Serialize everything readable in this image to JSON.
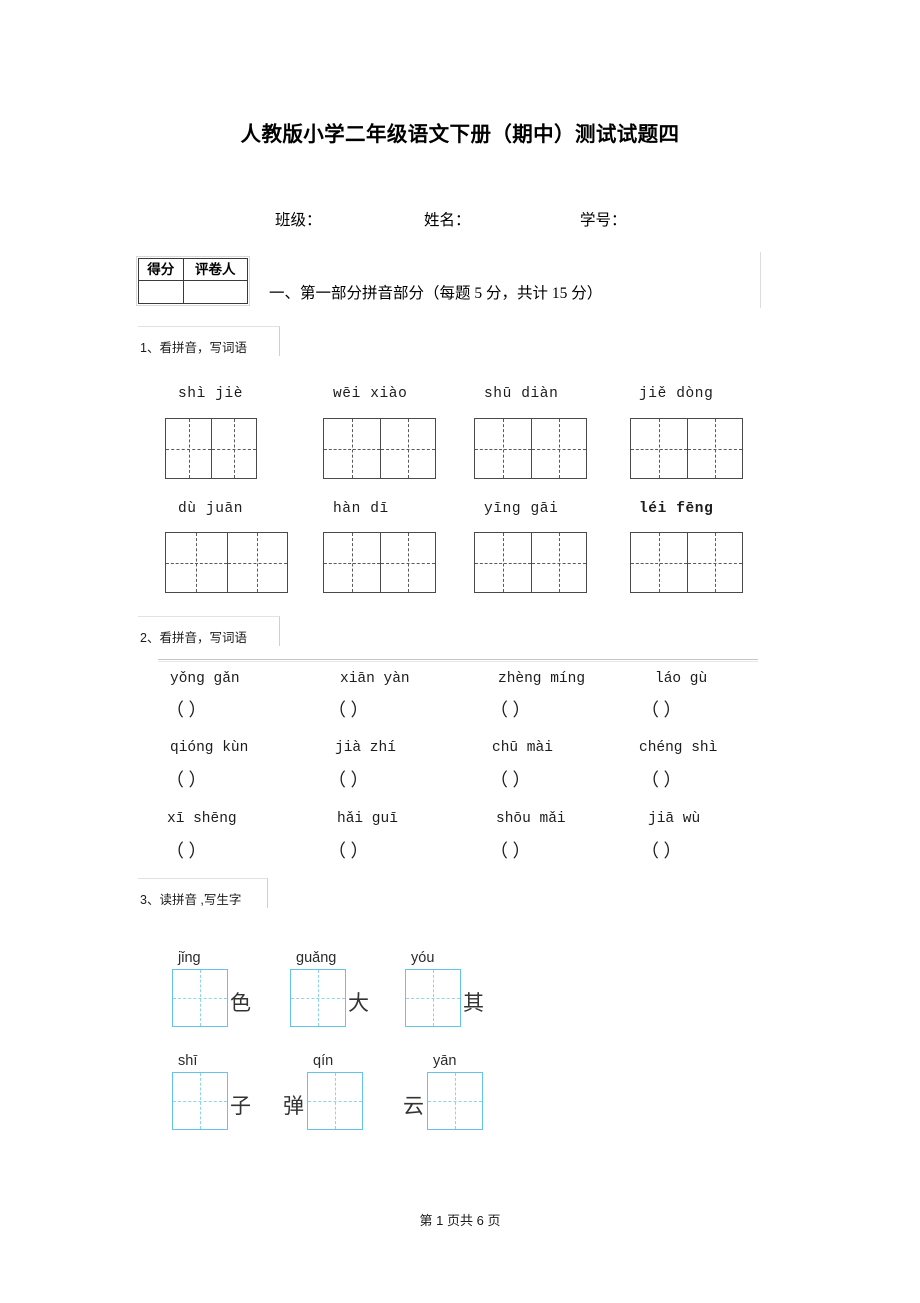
{
  "document": {
    "title": "人教版小学二年级语文下册（期中）测试试题四",
    "footer": "第    1 页共 6 页"
  },
  "student_info": {
    "fields": [
      {
        "label": "班级："
      },
      {
        "label": "姓名："
      },
      {
        "label": "学号："
      }
    ]
  },
  "score_table": {
    "headers": [
      "得分",
      "评卷人"
    ],
    "values": [
      "",
      ""
    ]
  },
  "section": {
    "heading": "一、第一部分拼音部分（每题  5 分，共计 15 分）"
  },
  "questions": [
    {
      "label": "1、看拼音，写词语",
      "rows": [
        [
          {
            "pinyin": "shì  jiè"
          },
          {
            "pinyin": "wēi  xiào"
          },
          {
            "pinyin": "shū  diàn"
          },
          {
            "pinyin": "jiě  dòng"
          }
        ],
        [
          {
            "pinyin": "dù   juān"
          },
          {
            "pinyin": "hàn   dī"
          },
          {
            "pinyin": "yīng  gāi"
          },
          {
            "pinyin": "léi fēng"
          }
        ]
      ]
    },
    {
      "label": "2、看拼音，写词语",
      "rows": [
        [
          {
            "pinyin": "yǒng  gǎn",
            "answer": "（                ）"
          },
          {
            "pinyin": "xiān yàn",
            "answer": "（                ）"
          },
          {
            "pinyin": "zhèng míng",
            "answer": "（                ）"
          },
          {
            "pinyin": "láo  gù",
            "answer": "（                ）"
          }
        ],
        [
          {
            "pinyin": "qióng kùn",
            "answer": "（                ）"
          },
          {
            "pinyin": "jià   zhí",
            "answer": "（                ）"
          },
          {
            "pinyin": "chū   mài",
            "answer": "（                ）"
          },
          {
            "pinyin": "chéng shì",
            "answer": "（                ）"
          }
        ],
        [
          {
            "pinyin": "xī shēng",
            "answer": "（                ）"
          },
          {
            "pinyin": "hǎi  guī",
            "answer": "（                ）"
          },
          {
            "pinyin": "shōu mǎi",
            "answer": "（                ）"
          },
          {
            "pinyin": "jiā  wù",
            "answer": "（                ）"
          }
        ]
      ]
    },
    {
      "label": "3、读拼音 ,写生字",
      "items": [
        {
          "pinyin": "jǐng",
          "char": "色",
          "char_position": "after"
        },
        {
          "pinyin": "guǎng",
          "char": "大",
          "char_position": "after"
        },
        {
          "pinyin": "yóu",
          "char": "其",
          "char_position": "after"
        },
        {
          "pinyin": "shī",
          "char": "子",
          "char_position": "after"
        },
        {
          "pinyin": "qín",
          "char": "弹",
          "char_position": "before"
        },
        {
          "pinyin": "yān",
          "char": "云",
          "char_position": "before"
        }
      ]
    }
  ],
  "colors": {
    "grid_black": "#4a4a4a",
    "grid_blue": "#62c4e8",
    "grid_blue_dash": "#8fd4ee"
  }
}
